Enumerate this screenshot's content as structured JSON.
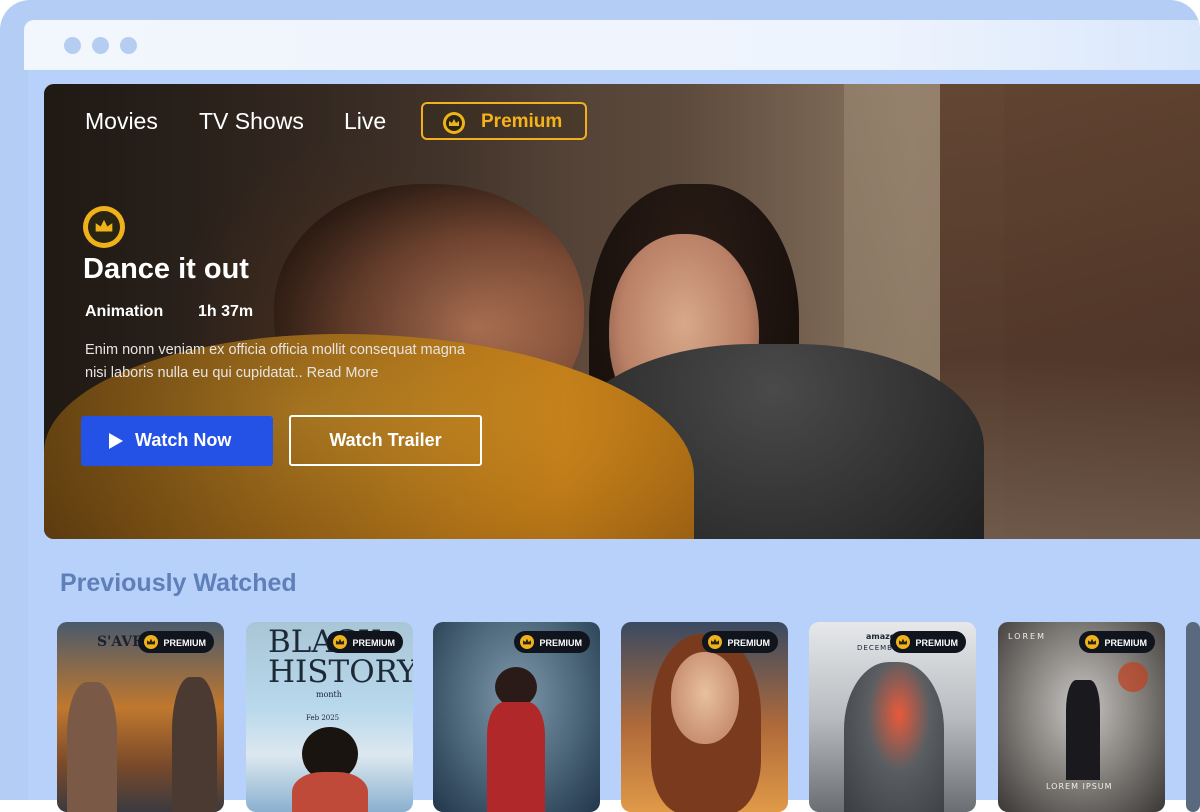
{
  "nav": {
    "items": [
      "Movies",
      "TV Shows",
      "Live"
    ],
    "premium_label": "Premium"
  },
  "hero": {
    "title": "Dance it out",
    "genre": "Animation",
    "duration": "1h 37m",
    "description": "Enim nonn veniam ex officia officia mollit consequat magna nisi laboris nulla eu qui cupidatat.. Read More",
    "watch_now_label": "Watch Now",
    "watch_trailer_label": "Watch Trailer"
  },
  "section": {
    "title": "Previously Watched"
  },
  "cards": [
    {
      "badge": "PREMIUM",
      "poster_text": "S'AVENGE"
    },
    {
      "badge": "PREMIUM",
      "poster_text": "BLACK HISTORY",
      "poster_sub": "month",
      "poster_date": "Feb   2025"
    },
    {
      "badge": "PREMIUM",
      "poster_text": ""
    },
    {
      "badge": "PREMIUM",
      "poster_text": ""
    },
    {
      "badge": "PREMIUM",
      "poster_text": "amazon",
      "poster_sub": "DECEMBER"
    },
    {
      "badge": "PREMIUM",
      "poster_text": "LOREM",
      "poster_sub": "LOREM IPSUM"
    }
  ],
  "colors": {
    "accent_blue": "#2451e6",
    "premium_gold": "#f2b01e",
    "page_bg": "#b7d1fb",
    "section_title": "#5f7fb8"
  },
  "icons": [
    "crown-icon",
    "play-icon",
    "window-dot"
  ]
}
